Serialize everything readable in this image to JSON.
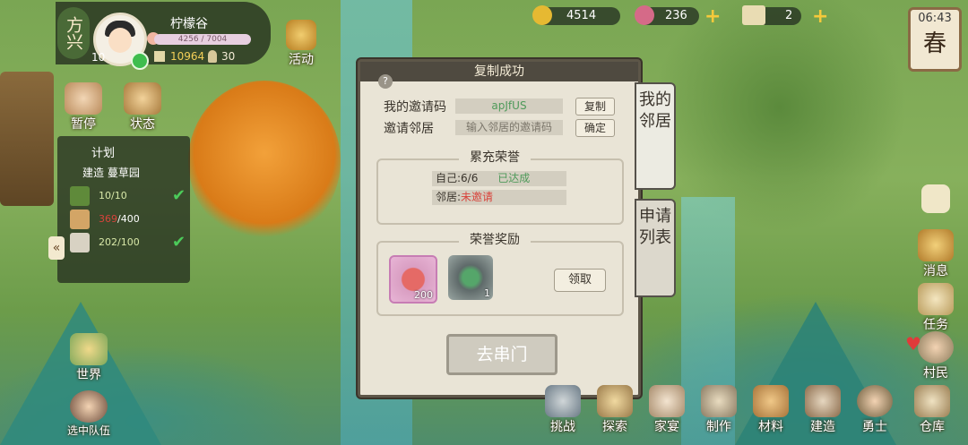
{
  "player": {
    "region": "方兴",
    "level": "10",
    "name": "柠檬谷",
    "hp": "4256 / 7004",
    "coins": "10964",
    "population": "30"
  },
  "top_buttons": {
    "activity": "活动",
    "pause": "暂停",
    "status": "状态"
  },
  "resources": {
    "copper": "4514",
    "gem": "236",
    "ticket": "2"
  },
  "clock": {
    "time": "06:43",
    "season": "春"
  },
  "plan": {
    "title": "计划",
    "task": "建造 蔓草园",
    "rows": [
      {
        "value": "10/10",
        "done": true
      },
      {
        "value_red": "369",
        "value_rest": "/400",
        "done": false
      },
      {
        "value": "202/100",
        "done": true
      }
    ]
  },
  "dialog": {
    "title": "复制成功",
    "my_code_label": "我的邀请码",
    "my_code": "apJfUS",
    "copy_btn": "复制",
    "invite_label": "邀请邻居",
    "invite_placeholder": "输入邻居的邀请码",
    "confirm_btn": "确定",
    "honor_title": "累充荣誉",
    "self_line": "自己:6/6",
    "self_status": "已达成",
    "neighbor_line": "邻居:",
    "neighbor_status": "未邀请",
    "reward_title": "荣誉奖励",
    "rewards": [
      {
        "name": "flower-token",
        "count": "200"
      },
      {
        "name": "jade-stone",
        "count": "1"
      }
    ],
    "claim_btn": "领取",
    "go_btn": "去串门"
  },
  "side_tabs": {
    "neighbors": "我的邻居",
    "applications": "申请列表"
  },
  "left_bottom": {
    "world": "世界",
    "team": "选中队伍"
  },
  "right_menu": {
    "message": "消息",
    "task": "任务",
    "villager": "村民"
  },
  "bottom_menu": [
    "挑战",
    "探索",
    "家宴",
    "制作",
    "材料",
    "建造",
    "勇士",
    "仓库"
  ],
  "colors": {
    "accent_gold": "#f5c93b",
    "done_green": "#4ccb5a",
    "warn_red": "#d8433b"
  }
}
